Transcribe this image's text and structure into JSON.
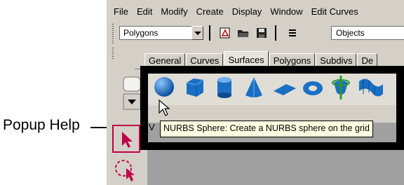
{
  "menubar": {
    "items": [
      "File",
      "Edit",
      "Modify",
      "Create",
      "Display",
      "Window",
      "Edit Curves"
    ]
  },
  "toolbar": {
    "mode_value": "Polygons",
    "selection_field_value": "Objects"
  },
  "shelf_tabs": {
    "items": [
      "General",
      "Curves",
      "Surfaces",
      "Polygons",
      "Subdivs",
      "De"
    ],
    "active": "Surfaces"
  },
  "shelf_icons": [
    "nurbs-sphere-icon",
    "nurbs-cube-icon",
    "nurbs-cylinder-icon",
    "nurbs-cone-icon",
    "nurbs-plane-icon",
    "nurbs-torus-icon",
    "revolve-icon",
    "loft-icon"
  ],
  "tooltip": {
    "text": "NURBS Sphere: Create a NURBS sphere on the grid"
  },
  "viewport": {
    "corner_label": "V"
  },
  "annotation": {
    "label": "Popup Help"
  },
  "colors": {
    "ui_gray": "#d4d0c8",
    "icon_blue": "#1a6fc4",
    "tooltip_bg": "#ffffe1",
    "select_tool_red": "#c0004a",
    "highlight_frame": "#000000"
  }
}
